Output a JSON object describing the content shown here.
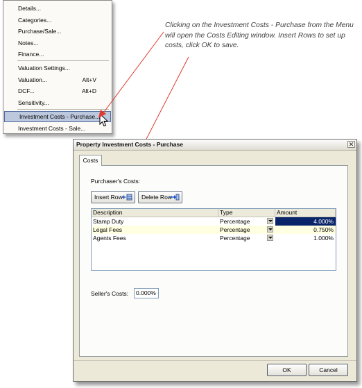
{
  "menu": {
    "items": [
      {
        "label": "Details..."
      },
      {
        "label": "Categories..."
      },
      {
        "label": "Purchase/Sale..."
      },
      {
        "label": "Notes..."
      },
      {
        "label": "Finance..."
      },
      {
        "label": "Valuation Settings..."
      },
      {
        "label": "Valuation...",
        "shortcut": "Alt+V"
      },
      {
        "label": "DCF...",
        "shortcut": "Alt+D"
      },
      {
        "label": "Sensitivity..."
      },
      {
        "label": "Investment Costs - Purchase...",
        "highlighted": true
      },
      {
        "label": "Investment Costs - Sale..."
      }
    ]
  },
  "annotation": {
    "text": "Clicking on the Investment Costs - Purchase from the Menu will open the Costs Editing window. Insert Rows to set up costs, click OK to save.",
    "arrow_color": "#e03a2e"
  },
  "dialog": {
    "title": "Property Investment Costs - Purchase",
    "close_glyph": "✕",
    "tab_label": "Costs",
    "purchasers_costs_label": "Purchaser's Costs:",
    "insert_row_label": "Insert Row",
    "delete_row_label": "Delete Row",
    "grid": {
      "columns": [
        "Description",
        "Type",
        "Amount"
      ],
      "rows": [
        {
          "description": "Stamp Duty",
          "type": "Percentage",
          "amount": "4.000%",
          "selected": true
        },
        {
          "description": "Legal Fees",
          "type": "Percentage",
          "amount": "0.750%"
        },
        {
          "description": "Agents Fees",
          "type": "Percentage",
          "amount": "1.000%"
        }
      ]
    },
    "sellers_costs_label": "Seller's Costs:",
    "sellers_costs_value": "0.000%",
    "ok_label": "OK",
    "cancel_label": "Cancel"
  },
  "colors": {
    "selection": "#0a246a",
    "row_highlight": "#ffffe1",
    "menu_highlight": "#bcc8dd"
  }
}
